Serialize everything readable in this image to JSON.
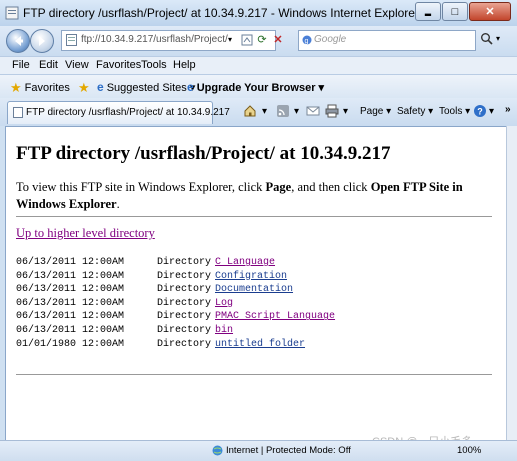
{
  "window": {
    "title": "FTP directory /usrflash/Project/ at 10.34.9.217 - Windows Internet Explorer",
    "minimize_glyph": "▂",
    "maximize_glyph": "□",
    "close_glyph": "✕"
  },
  "address_bar": {
    "url": "ftp://10.34.9.217/usrflash/Project/",
    "search_placeholder": "Google",
    "refresh_glyph": "⟳",
    "stop_glyph": "✕"
  },
  "menu": [
    "File",
    "Edit",
    "View",
    "Favorites",
    "Tools",
    "Help"
  ],
  "favorites_bar": {
    "favorites_label": "Favorites",
    "suggested_sites_label": "Suggested Sites ▾",
    "upgrade_label": "Upgrade Your Browser ▾"
  },
  "tab": {
    "label": "FTP directory /usrflash/Project/ at 10.34.9.217"
  },
  "command_bar": {
    "page_label": "Page ▾",
    "safety_label": "Safety ▾",
    "tools_label": "Tools ▾",
    "help_label": "▾"
  },
  "content": {
    "heading": "FTP directory /usrflash/Project/ at 10.34.9.217",
    "intro_1": "To view this FTP site in Windows Explorer, click ",
    "intro_page": "Page",
    "intro_2": ", and then click ",
    "intro_open": "Open FTP Site in Windows Explorer",
    "intro_3": ".",
    "up_link": "Up to higher level directory",
    "entries": [
      {
        "date": "06/13/2011 12:00AM",
        "kind": "Directory",
        "name": "C Language",
        "color": "#800080"
      },
      {
        "date": "06/13/2011 12:00AM",
        "kind": "Directory",
        "name": "Configration",
        "color": "#1a3d8f"
      },
      {
        "date": "06/13/2011 12:00AM",
        "kind": "Directory",
        "name": "Documentation",
        "color": "#1a3d8f"
      },
      {
        "date": "06/13/2011 12:00AM",
        "kind": "Directory",
        "name": "Log",
        "color": "#800080"
      },
      {
        "date": "06/13/2011 12:00AM",
        "kind": "Directory",
        "name": "PMAC Script Language",
        "color": "#800080"
      },
      {
        "date": "06/13/2011 12:00AM",
        "kind": "Directory",
        "name": "bin",
        "color": "#800080"
      },
      {
        "date": "01/01/1980 12:00AM",
        "kind": "Directory",
        "name": "untitled folder",
        "color": "#1a3d8f"
      }
    ]
  },
  "status_bar": {
    "zone": "Internet | Protected Mode: Off",
    "zoom": "100%"
  },
  "watermark": "CSDN @一只小毛多"
}
